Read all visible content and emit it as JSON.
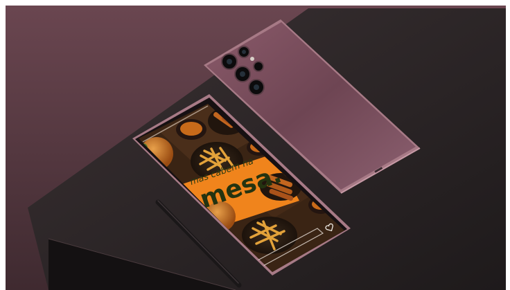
{
  "scene": {
    "description_free": true,
    "colors": {
      "frame": "#ffffff",
      "wall_top": "#5a3a40",
      "wall_bottom": "#3a262b",
      "table_top": "#2a2325",
      "table_side": "#141112",
      "phone_back": "#7a4e5c",
      "phone_back_light": "#9a6676",
      "phone_edge": "#a77a86",
      "screen_bg": "#3a2414",
      "banner_orange": "#f0841c",
      "ad_text": "#243310",
      "fries": "#e3a23a",
      "sauce": "#c86a1a",
      "bun": "#c9721e"
    },
    "icons": [
      "camera-lens-icon",
      "flash-icon",
      "heart-icon",
      "pen-stylus"
    ]
  },
  "screen_ad": {
    "line1": "mas cabem na",
    "line2": "mesa."
  }
}
